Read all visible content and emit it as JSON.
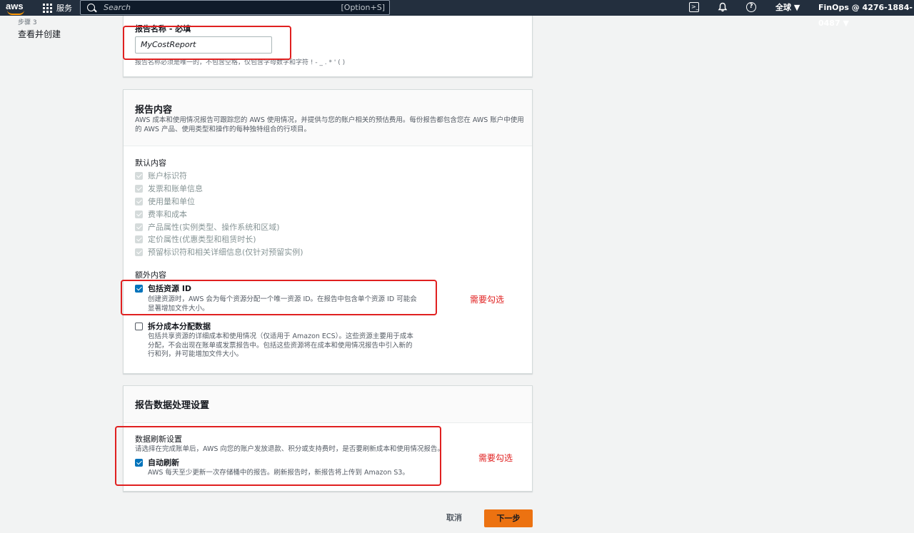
{
  "topbar": {
    "logo": "aws",
    "services_label": "服务",
    "search_placeholder": "Search",
    "search_shortcut": "[Option+S]",
    "region": "全球 ▼",
    "account": "FinOps @ 4276-1884-0487 ▼",
    "icons": [
      "grid-icon",
      "search-icon",
      "terminal-icon",
      "bell-icon",
      "help-icon"
    ]
  },
  "left_nav": {
    "step": "步骤 3",
    "label": "查看并创建"
  },
  "report_name": {
    "label": "报告名称 - 必填",
    "value": "MyCostReport",
    "hint": "报告名称必须是唯一的，不包含空格，仅包含字母数字和字符 ! - _ . * ' ( )"
  },
  "report_content": {
    "title": "报告内容",
    "description": "AWS 成本和使用情况报告可跟踪您的 AWS 使用情况，并提供与您的账户相关的预估费用。每份报告都包含您在 AWS 账户中使用的 AWS 产品、使用类型和操作的每种独特组合的行项目。",
    "default_title": "默认内容",
    "default_items": [
      "账户标识符",
      "发票和账单信息",
      "使用量和单位",
      "费率和成本",
      "产品属性(实例类型、操作系统和区域)",
      "定价属性(优惠类型和租赁时长)",
      "预留标识符和相关详细信息(仅针对预留实例)"
    ],
    "extra_title": "额外内容",
    "include_resource_id": {
      "label": "包括资源 ID",
      "checked": true,
      "desc": [
        "创建资源时，AWS 会为每个资源分配一个唯一资源 ID。在报告中包含单个资源 ID 可能会",
        "显著增加文件大小。"
      ]
    },
    "split_cost": {
      "label": "拆分成本分配数据",
      "checked": false,
      "desc": [
        "包括共享资源的详细成本和使用情况（仅适用于 Amazon ECS）。这些资源主要用于成本",
        "分配，不会出现在账单或发票报告中。包括这些资源将在成本和使用情况报告中引入新的",
        "行和列，并可能增加文件大小。"
      ]
    },
    "note": "需要勾选"
  },
  "data_processing": {
    "title": "报告数据处理设置",
    "refresh_title": "数据刷新设置",
    "refresh_desc": "请选择在完成账单后，AWS 向您的账户发放退款、积分或支持费时，是否要刷新成本和使用情况报告。",
    "auto_refresh": {
      "label": "自动刷新",
      "checked": true,
      "desc": "AWS 每天至少更新一次存储桶中的报告。刷新报告时，新报告将上传到 Amazon S3。"
    },
    "note": "需要勾选"
  },
  "actions": {
    "cancel": "取消",
    "next": "下一步"
  },
  "colors": {
    "topbar": "#232f3e",
    "accent": "#ec7211",
    "annotation": "#e02020",
    "checkbox": "#0073bb"
  }
}
